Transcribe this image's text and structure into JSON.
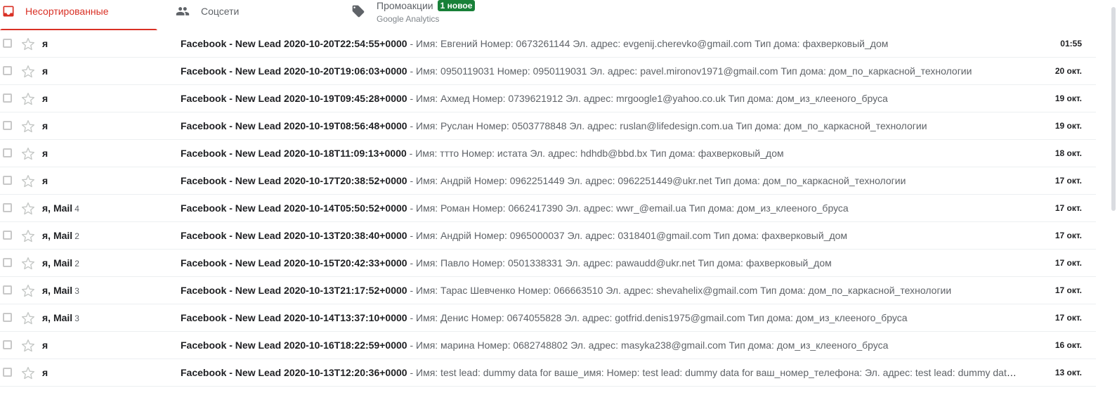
{
  "tabs": [
    {
      "label": "Несортированные",
      "icon": "inbox-icon",
      "selected": true
    },
    {
      "label": "Соцсети",
      "icon": "people-icon",
      "selected": false
    },
    {
      "label": "Промоакции",
      "icon": "tag-icon",
      "badge": "1 новое",
      "sub": "Google Analytics",
      "selected": false
    }
  ],
  "colors": {
    "accent": "#d93025",
    "badge": "#188038"
  },
  "emails": [
    {
      "sender": "я",
      "count": "",
      "subject": "Facebook - New Lead 2020-10-20T22:54:55+0000",
      "snippet": " - Имя: Евгений Номер: 0673261144 Эл. адрес: evgenij.cherevko@gmail.com Тип дома: фахверковый_дом",
      "date": "01:55"
    },
    {
      "sender": "я",
      "count": "",
      "subject": "Facebook - New Lead 2020-10-20T19:06:03+0000",
      "snippet": " - Имя: 0950119031 Номер: 0950119031 Эл. адрес: pavel.mironov1971@gmail.com Тип дома: дом_по_каркасной_технологии",
      "date": "20 окт."
    },
    {
      "sender": "я",
      "count": "",
      "subject": "Facebook - New Lead 2020-10-19T09:45:28+0000",
      "snippet": " - Имя: Ахмед Номер: 0739621912 Эл. адрес: mrgoogle1@yahoo.co.uk Тип дома: дом_из_клееного_бруса",
      "date": "19 окт."
    },
    {
      "sender": "я",
      "count": "",
      "subject": "Facebook - New Lead 2020-10-19T08:56:48+0000",
      "snippet": " - Имя: Руслан Номер: 0503778848 Эл. адрес: ruslan@lifedesign.com.ua Тип дома: дом_по_каркасной_технологии",
      "date": "19 окт."
    },
    {
      "sender": "я",
      "count": "",
      "subject": "Facebook - New Lead 2020-10-18T11:09:13+0000",
      "snippet": " - Имя: ттто Номер: истата Эл. адрес: hdhdb@bbd.bx Тип дома: фахверковый_дом",
      "date": "18 окт."
    },
    {
      "sender": "я",
      "count": "",
      "subject": "Facebook - New Lead 2020-10-17T20:38:52+0000",
      "snippet": " - Имя: Андрій Номер: 0962251449 Эл. адрес: 0962251449@ukr.net Тип дома: дом_по_каркасной_технологии",
      "date": "17 окт."
    },
    {
      "sender": "я, Mail",
      "count": "4",
      "subject": "Facebook - New Lead 2020-10-14T05:50:52+0000",
      "snippet": " - Имя: Роман Номер: 0662417390 Эл. адрес: wwr_@email.ua Тип дома: дом_из_клееного_бруса",
      "date": "17 окт."
    },
    {
      "sender": "я, Mail",
      "count": "2",
      "subject": "Facebook - New Lead 2020-10-13T20:38:40+0000",
      "snippet": " - Имя: Андрій Номер: 0965000037 Эл. адрес: 0318401@gmail.com Тип дома: фахверковый_дом",
      "date": "17 окт."
    },
    {
      "sender": "я, Mail",
      "count": "2",
      "subject": "Facebook - New Lead 2020-10-15T20:42:33+0000",
      "snippet": " - Имя: Павло Номер: 0501338331 Эл. адрес: pawaudd@ukr.net Тип дома: фахверковый_дом",
      "date": "17 окт."
    },
    {
      "sender": "я, Mail",
      "count": "3",
      "subject": "Facebook - New Lead 2020-10-13T21:17:52+0000",
      "snippet": " - Имя: Тарас Шевченко Номер: 066663510 Эл. адрес: shevahelix@gmail.com Тип дома: дом_по_каркасной_технологии",
      "date": "17 окт."
    },
    {
      "sender": "я, Mail",
      "count": "3",
      "subject": "Facebook - New Lead 2020-10-14T13:37:10+0000",
      "snippet": " - Имя: Денис Номер: 0674055828 Эл. адрес: gotfrid.denis1975@gmail.com Тип дома: дом_из_клееного_бруса",
      "date": "17 окт."
    },
    {
      "sender": "я",
      "count": "",
      "subject": "Facebook - New Lead 2020-10-16T18:22:59+0000",
      "snippet": " - Имя: марина Номер: 0682748802 Эл. адрес: masyka238@gmail.com Тип дома: дом_из_клееного_бруса",
      "date": "16 окт."
    },
    {
      "sender": "я",
      "count": "",
      "subject": "Facebook - New Lead 2020-10-13T12:20:36+0000",
      "snippet": " - Имя: test lead: dummy data for ваше_имя: Номер: test lead: dummy data for ваш_номер_телефона: Эл. адрес: test lead: dummy data for ваш_email",
      "date": "13 окт."
    }
  ]
}
